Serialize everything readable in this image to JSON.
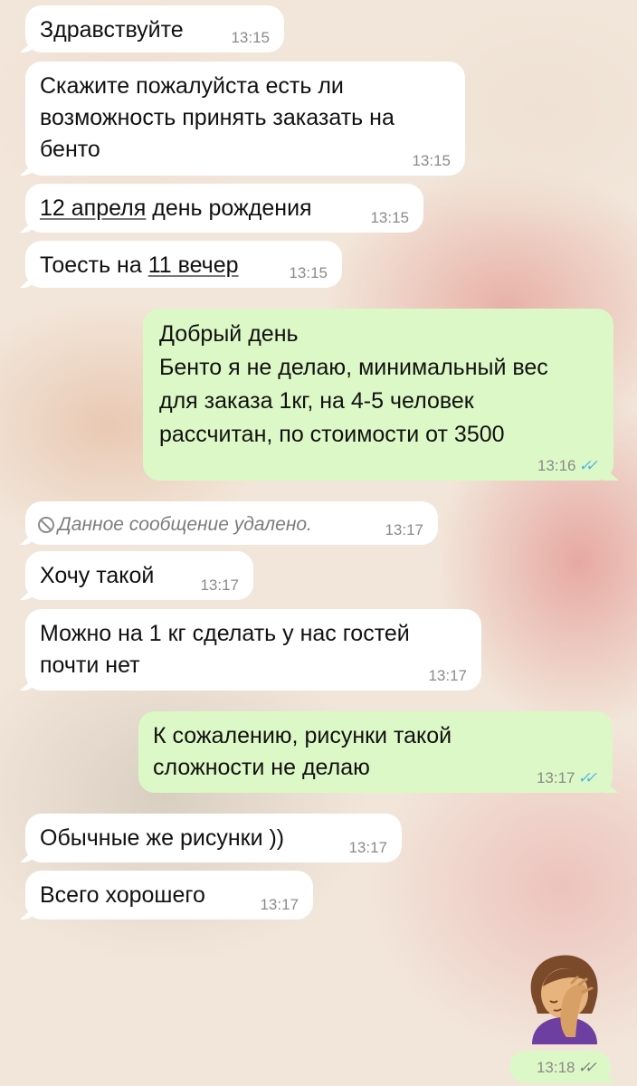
{
  "chat": {
    "messages": [
      {
        "id": 1,
        "direction": "incoming",
        "text": "Здравствуйте",
        "time": "13:15"
      },
      {
        "id": 2,
        "direction": "incoming",
        "text": "Скажите пожалуйста есть ли\nвозможность принять заказать на\nбенто",
        "time": "13:15"
      },
      {
        "id": 3,
        "direction": "incoming",
        "link": "12 апреля",
        "text": " день рождения",
        "time": "13:15"
      },
      {
        "id": 4,
        "direction": "incoming",
        "text": "Тоесть на ",
        "link": "11 вечер",
        "time": "13:15"
      },
      {
        "id": 5,
        "direction": "outgoing",
        "text": "Добрый день\nБенто я не делаю, минимальный вес\nдля заказа 1кг, на 4-5 человек\nрассчитан, по стоимости от 3500",
        "time": "13:16",
        "status": "read"
      },
      {
        "id": 6,
        "direction": "incoming",
        "deleted": true,
        "text": "Данное сообщение удалено.",
        "time": "13:17"
      },
      {
        "id": 7,
        "direction": "incoming",
        "text": "Хочу такой",
        "time": "13:17"
      },
      {
        "id": 8,
        "direction": "incoming",
        "text": "Можно на 1 кг сделать у нас гостей\nпочти нет",
        "time": "13:17"
      },
      {
        "id": 9,
        "direction": "outgoing",
        "text": "К сожалению, рисунки такой\nсложности не делаю",
        "time": "13:17",
        "status": "read"
      },
      {
        "id": 10,
        "direction": "incoming",
        "text": "Обычные же рисунки ))",
        "time": "13:17"
      },
      {
        "id": 11,
        "direction": "incoming",
        "text": "Всего хорошего",
        "time": "13:17"
      },
      {
        "id": 12,
        "direction": "outgoing",
        "sticker": "woman-facepalming-emoji",
        "time": "13:18",
        "status": "delivered"
      }
    ],
    "tick_glyph": "✓✓",
    "colors": {
      "incoming_bubble": "#ffffff",
      "outgoing_bubble": "#dcf8c6",
      "read_ticks": "#4fb3e6",
      "time_text": "#8a8a8a"
    }
  }
}
